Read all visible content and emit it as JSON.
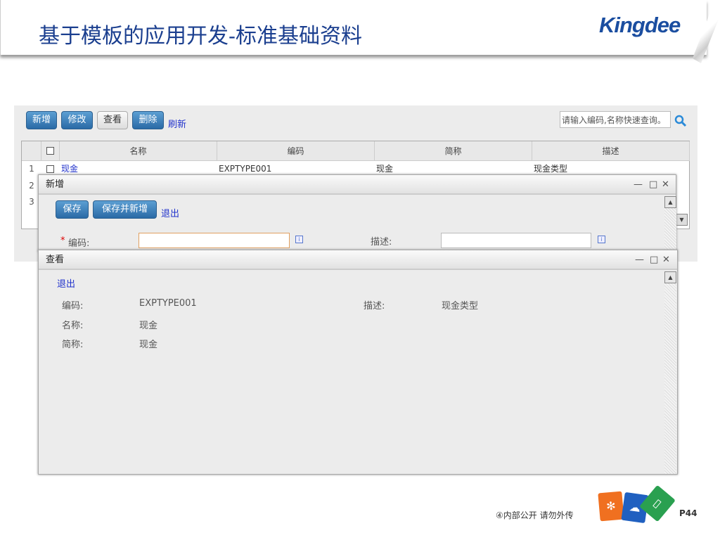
{
  "header": {
    "title": "基于模板的应用开发-标准基础资料",
    "logo": "Kingdee"
  },
  "toolbar": {
    "new": "新增",
    "edit": "修改",
    "view": "查看",
    "delete": "删除",
    "refresh": "刷新",
    "search_placeholder": "请输入编码,名称快速查询。"
  },
  "table": {
    "columns": [
      "名称",
      "编码",
      "简称",
      "描述"
    ],
    "rows": [
      {
        "num": "1",
        "name": "现金",
        "code": "EXPTYPE001",
        "short": "现金",
        "desc": "现金类型"
      },
      {
        "num": "2"
      },
      {
        "num": "3"
      }
    ]
  },
  "new_dialog": {
    "title": "新增",
    "save": "保存",
    "save_new": "保存并新增",
    "exit": "退出",
    "required_mark": "*",
    "code_label": "编码:",
    "desc_label": "描述:",
    "code_value": "",
    "desc_value": ""
  },
  "view_dialog": {
    "title": "查看",
    "exit": "退出",
    "code_label": "编码:",
    "code_value": "EXPTYPE001",
    "desc_label": "描述:",
    "desc_value": "现金类型",
    "name_label": "名称:",
    "name_value": "现金",
    "short_label": "简称:",
    "short_value": "现金"
  },
  "window_controls": {
    "minimize": "—",
    "maximize": "□",
    "close": "✕"
  },
  "footer": {
    "notice": "④内部公开 请勿外传",
    "page": "P44"
  }
}
